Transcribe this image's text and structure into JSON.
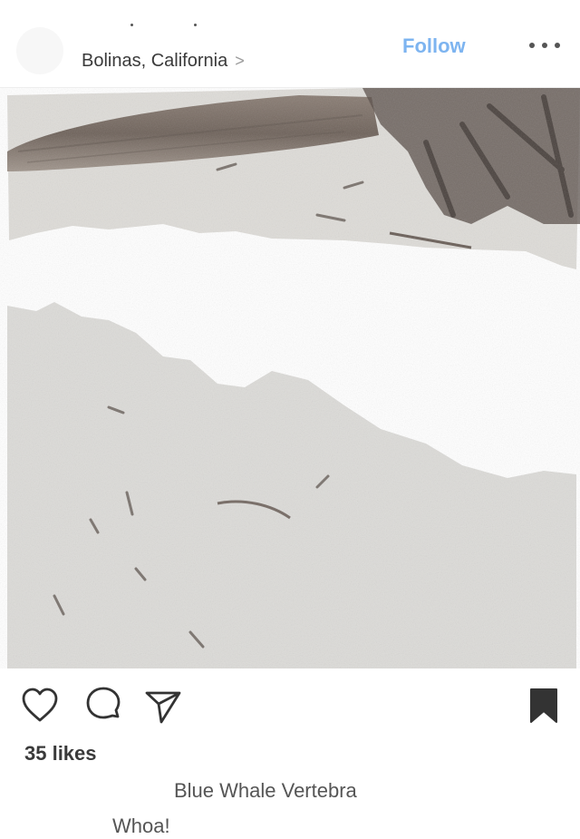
{
  "post": {
    "location": "Bolinas, California",
    "location_chevron": ">",
    "follow_label": "Follow",
    "image_alt_icon": "torn-photo-beach-vertebra",
    "likes": "35 likes",
    "caption": "Blue Whale Vertebra",
    "comment": "Whoa!"
  },
  "icons": {
    "like": "heart-icon",
    "comment": "comment-icon",
    "share": "send-icon",
    "save": "bookmark-icon",
    "more": "more-icon"
  },
  "colors": {
    "follow": "#7db4f0",
    "text": "#262626",
    "sand": "#dcdbd8"
  }
}
